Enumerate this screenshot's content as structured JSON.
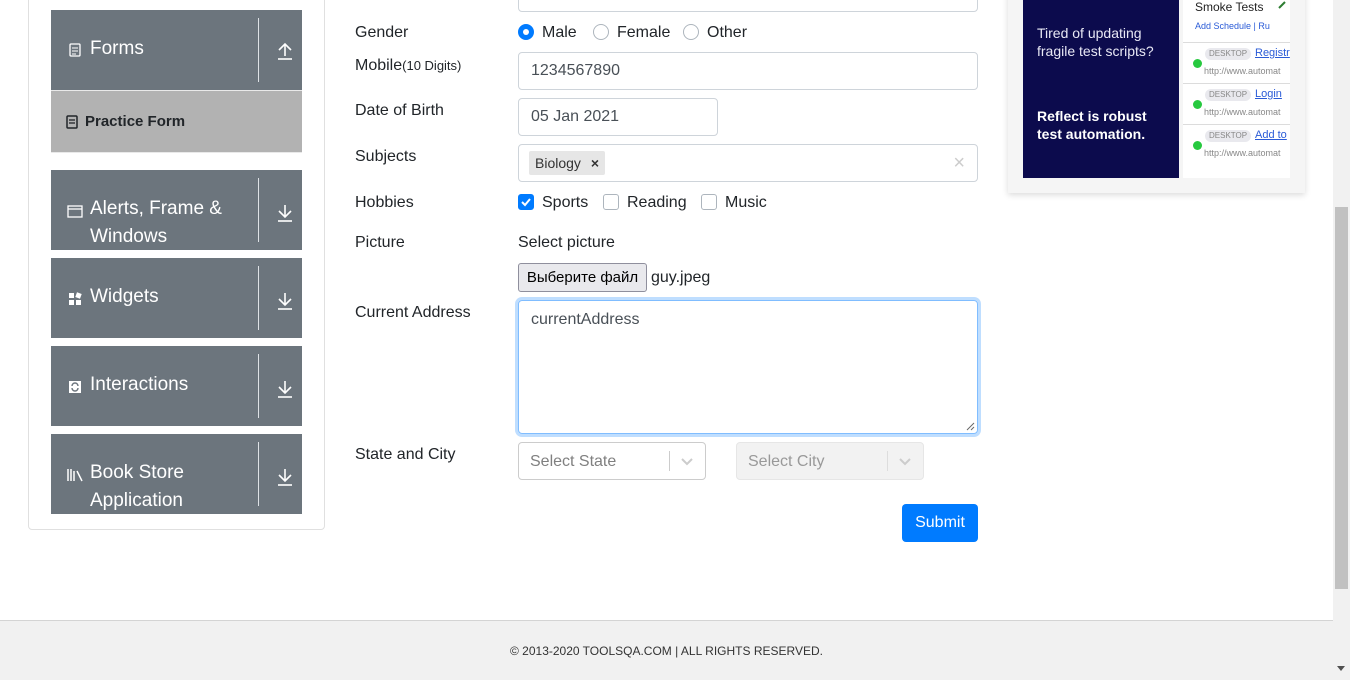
{
  "sidebar": {
    "groups": [
      {
        "label": "Forms",
        "icon": "document-icon",
        "expanded": true
      },
      {
        "label": "Alerts, Frame &",
        "label2": "Windows",
        "icon": "window-icon"
      },
      {
        "label": "Widgets",
        "icon": "widgets-icon"
      },
      {
        "label": "Interactions",
        "icon": "interactions-icon"
      },
      {
        "label": "Book Store",
        "label2": "Application",
        "icon": "books-icon"
      }
    ],
    "active_item": {
      "label": "Practice Form",
      "icon": "form-icon"
    }
  },
  "form": {
    "gender": {
      "label": "Gender",
      "options": [
        "Male",
        "Female",
        "Other"
      ],
      "selected": "Male"
    },
    "mobile": {
      "label": "Mobile",
      "hint": "(10 Digits)",
      "value": "1234567890"
    },
    "dob": {
      "label": "Date of Birth",
      "value": "05 Jan 2021"
    },
    "subjects": {
      "label": "Subjects",
      "chips": [
        "Biology"
      ],
      "chip_remove": "×",
      "clear": "×"
    },
    "hobbies": {
      "label": "Hobbies",
      "options": [
        "Sports",
        "Reading",
        "Music"
      ],
      "checked": [
        "Sports"
      ]
    },
    "picture": {
      "label": "Picture",
      "select_label": "Select picture",
      "button_label": "Выберите файл",
      "file_name": "guy.jpeg"
    },
    "address": {
      "label": "Current Address",
      "value": "currentAddress"
    },
    "state_city": {
      "label": "State and City",
      "state_placeholder": "Select State",
      "city_placeholder": "Select City"
    },
    "submit_label": "Submit"
  },
  "ad": {
    "text1": "Tired of updating fragile test scripts?",
    "text2": "Reflect is robust test automation.",
    "list_title": "Smoke Tests",
    "list_actions": "Add Schedule  |  Ru",
    "rows": [
      {
        "tag": "DESKTOP",
        "name": "Registr",
        "url": "http://www.automat"
      },
      {
        "tag": "DESKTOP",
        "name": "Login",
        "url": "http://www.automat"
      },
      {
        "tag": "DESKTOP",
        "name": "Add to",
        "url": "http://www.automat"
      }
    ]
  },
  "footer": {
    "text": "© 2013-2020 TOOLSQA.COM | ALL RIGHTS RESERVED."
  },
  "colors": {
    "sidebar_group": "#6c757d",
    "active_item": "#b2b2b2",
    "primary": "#007bff",
    "ad_dark": "#0c0b4d"
  }
}
